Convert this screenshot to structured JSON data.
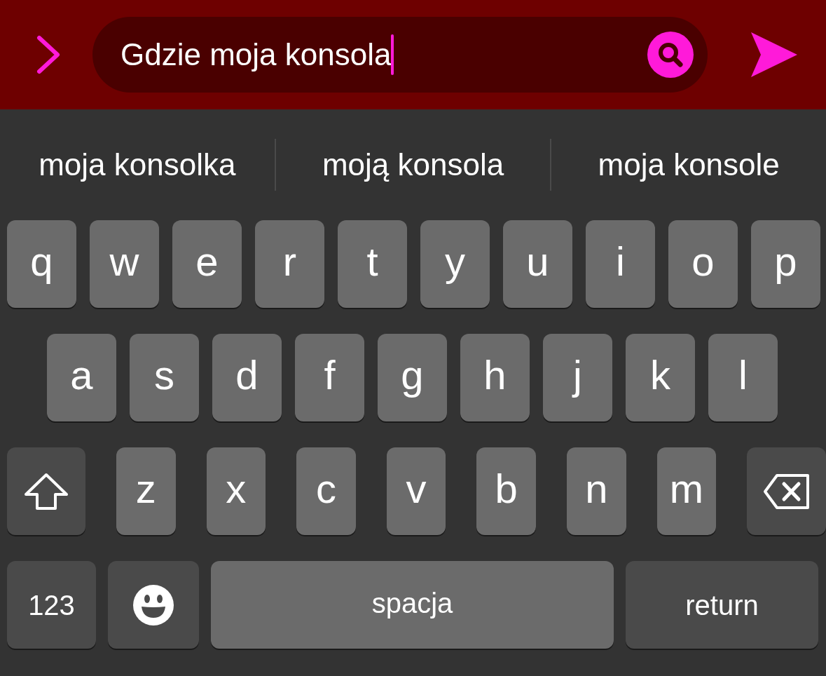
{
  "search": {
    "value": "Gdzie moja konsola"
  },
  "suggestions": [
    "moja konsolka",
    "moją konsola",
    "moja konsole"
  ],
  "keyboard": {
    "rows": [
      [
        {
          "kind": "letter",
          "label": "q"
        },
        {
          "kind": "letter",
          "label": "w"
        },
        {
          "kind": "letter",
          "label": "e"
        },
        {
          "kind": "letter",
          "label": "r"
        },
        {
          "kind": "letter",
          "label": "t"
        },
        {
          "kind": "letter",
          "label": "y"
        },
        {
          "kind": "letter",
          "label": "u"
        },
        {
          "kind": "letter",
          "label": "i"
        },
        {
          "kind": "letter",
          "label": "o"
        },
        {
          "kind": "letter",
          "label": "p"
        }
      ],
      [
        {
          "kind": "letter",
          "label": "a"
        },
        {
          "kind": "letter",
          "label": "s"
        },
        {
          "kind": "letter",
          "label": "d"
        },
        {
          "kind": "letter",
          "label": "f"
        },
        {
          "kind": "letter",
          "label": "g"
        },
        {
          "kind": "letter",
          "label": "h"
        },
        {
          "kind": "letter",
          "label": "j"
        },
        {
          "kind": "letter",
          "label": "k"
        },
        {
          "kind": "letter",
          "label": "l"
        }
      ],
      [
        {
          "kind": "shift"
        },
        {
          "kind": "letter",
          "label": "z"
        },
        {
          "kind": "letter",
          "label": "x"
        },
        {
          "kind": "letter",
          "label": "c"
        },
        {
          "kind": "letter",
          "label": "v"
        },
        {
          "kind": "letter",
          "label": "b"
        },
        {
          "kind": "letter",
          "label": "n"
        },
        {
          "kind": "letter",
          "label": "m"
        },
        {
          "kind": "backspace"
        }
      ]
    ],
    "bottom_bar": [
      {
        "kind": "mode",
        "label": "123"
      },
      {
        "kind": "emoji"
      },
      {
        "kind": "space",
        "label": "spacja"
      },
      {
        "kind": "return",
        "label": "return"
      }
    ]
  }
}
